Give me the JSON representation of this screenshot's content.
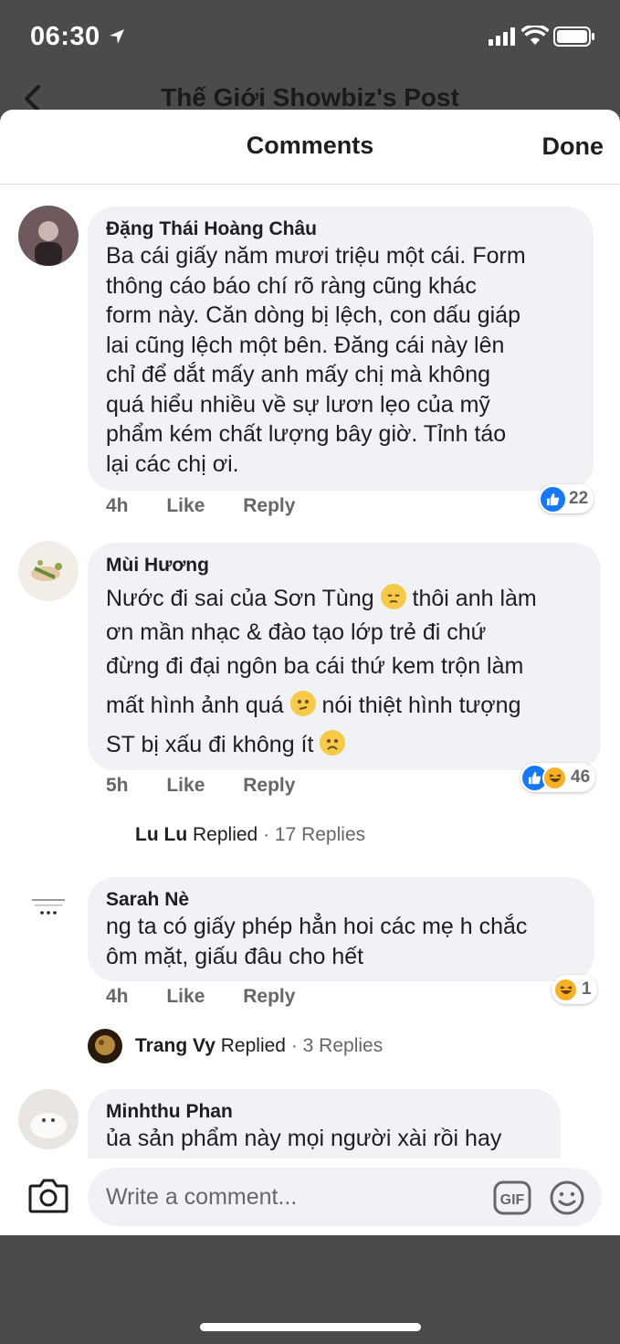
{
  "status_bar": {
    "time": "06:30"
  },
  "post_header": {
    "title": "Thế Giới Showbiz's Post"
  },
  "sheet": {
    "title": "Comments",
    "done_label": "Done"
  },
  "comments": [
    {
      "author": "Đặng Thái Hoàng Châu",
      "lines": [
        "Ba cái giấy năm mươi triệu một cái. Form",
        "thông cáo báo chí rõ ràng cũng khác",
        "form này. Căn dòng bị lệch, con dấu giáp",
        "lai cũng lệch một bên. Đăng cái này lên",
        "chỉ để dắt mấy anh mấy chị mà không",
        "quá hiểu nhiều về sự lươn lẹo của mỹ",
        "phẩm kém chất lượng bây giờ. Tỉnh táo",
        "lại các chị ơi."
      ],
      "time": "4h",
      "like": "Like",
      "reply": "Reply",
      "reaction_count": "22"
    },
    {
      "author": "Mùi Hương",
      "lines": [
        "Nước đi sai của Sơn Tùng",
        "thôi anh làm",
        "ơn mần nhạc & đào tạo lớp trẻ đi chứ",
        "đừng đi đại ngôn ba cái thứ kem trộn làm",
        "mất hình ảnh quá",
        "nói thiệt hình tượng",
        "ST bị xấu đi không ít"
      ],
      "emojis": [
        "pensive-face",
        "confused-face",
        "frowning-face"
      ],
      "time": "5h",
      "like": "Like",
      "reply": "Reply",
      "reaction_count": "46",
      "replies": {
        "name": "Lu Lu",
        "replied": "Replied",
        "count": "· 17 Replies"
      }
    },
    {
      "author": "Sarah Nè",
      "lines": [
        "ng ta có giấy phép hẳn hoi các mẹ h chắc",
        "ôm mặt, giấu đâu cho hết"
      ],
      "time": "4h",
      "like": "Like",
      "reply": "Reply",
      "reaction_count": "1",
      "replies": {
        "name": "Trang Vy",
        "replied": "Replied",
        "count": "· 3 Replies"
      }
    },
    {
      "author": "Minhthu Phan",
      "lines": [
        "ủa sản phẩm này mọi người xài rồi hay"
      ]
    }
  ],
  "composer": {
    "placeholder": "Write a comment..."
  },
  "colors": {
    "like_blue": "#1877f2",
    "bubble_gray": "#f0f2f5",
    "meta_gray": "#65676b"
  }
}
